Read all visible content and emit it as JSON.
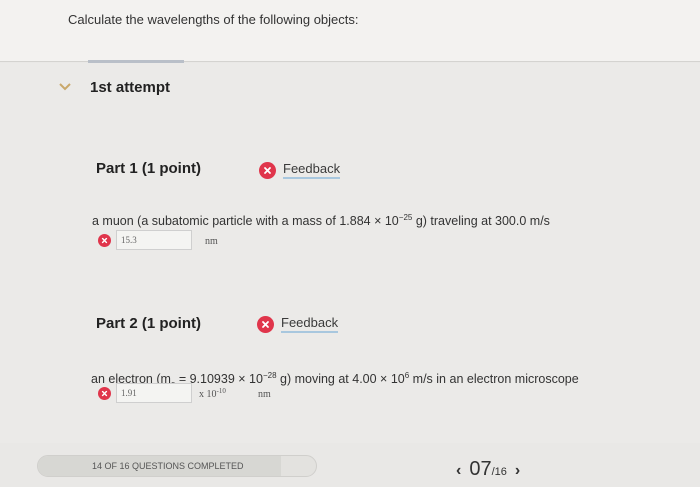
{
  "header": {
    "question": "Calculate the wavelengths of the following objects:"
  },
  "attempt": {
    "title": "1st attempt"
  },
  "parts": [
    {
      "title": "Part 1   (1 point)",
      "feedback_label": "Feedback",
      "prompt_a": "a muon (a subatomic particle with a mass of 1.884 × 10",
      "prompt_exp": "−25",
      "prompt_b": " g) traveling at 300.0 m/s",
      "answer_value": "15.3",
      "unit": "nm"
    },
    {
      "title": "Part 2   (1 point)",
      "feedback_label": "Feedback",
      "prompt_a": "an electron (m",
      "prompt_sub": "e",
      "prompt_b": " = 9.10939 × 10",
      "prompt_exp": "−28",
      "prompt_c": " g) moving at 4.00 × 10",
      "prompt_exp2": "6",
      "prompt_d": " m/s in an electron microscope",
      "answer_value": "1.91",
      "multiplier": "x 10",
      "multiplier_exp": "-10",
      "unit": "nm"
    }
  ],
  "footer": {
    "progress_text": "14 OF 16 QUESTIONS COMPLETED",
    "progress_fraction": 0.875,
    "page_current": "07",
    "page_total": "/16",
    "prev_arrow": "‹",
    "next_arrow": "›"
  },
  "colors": {
    "error": "#e0354b",
    "feedback_underline": "#a8c7de"
  },
  "icons": {
    "chevron": "chevron-down-icon",
    "error": "x-circle-icon"
  }
}
